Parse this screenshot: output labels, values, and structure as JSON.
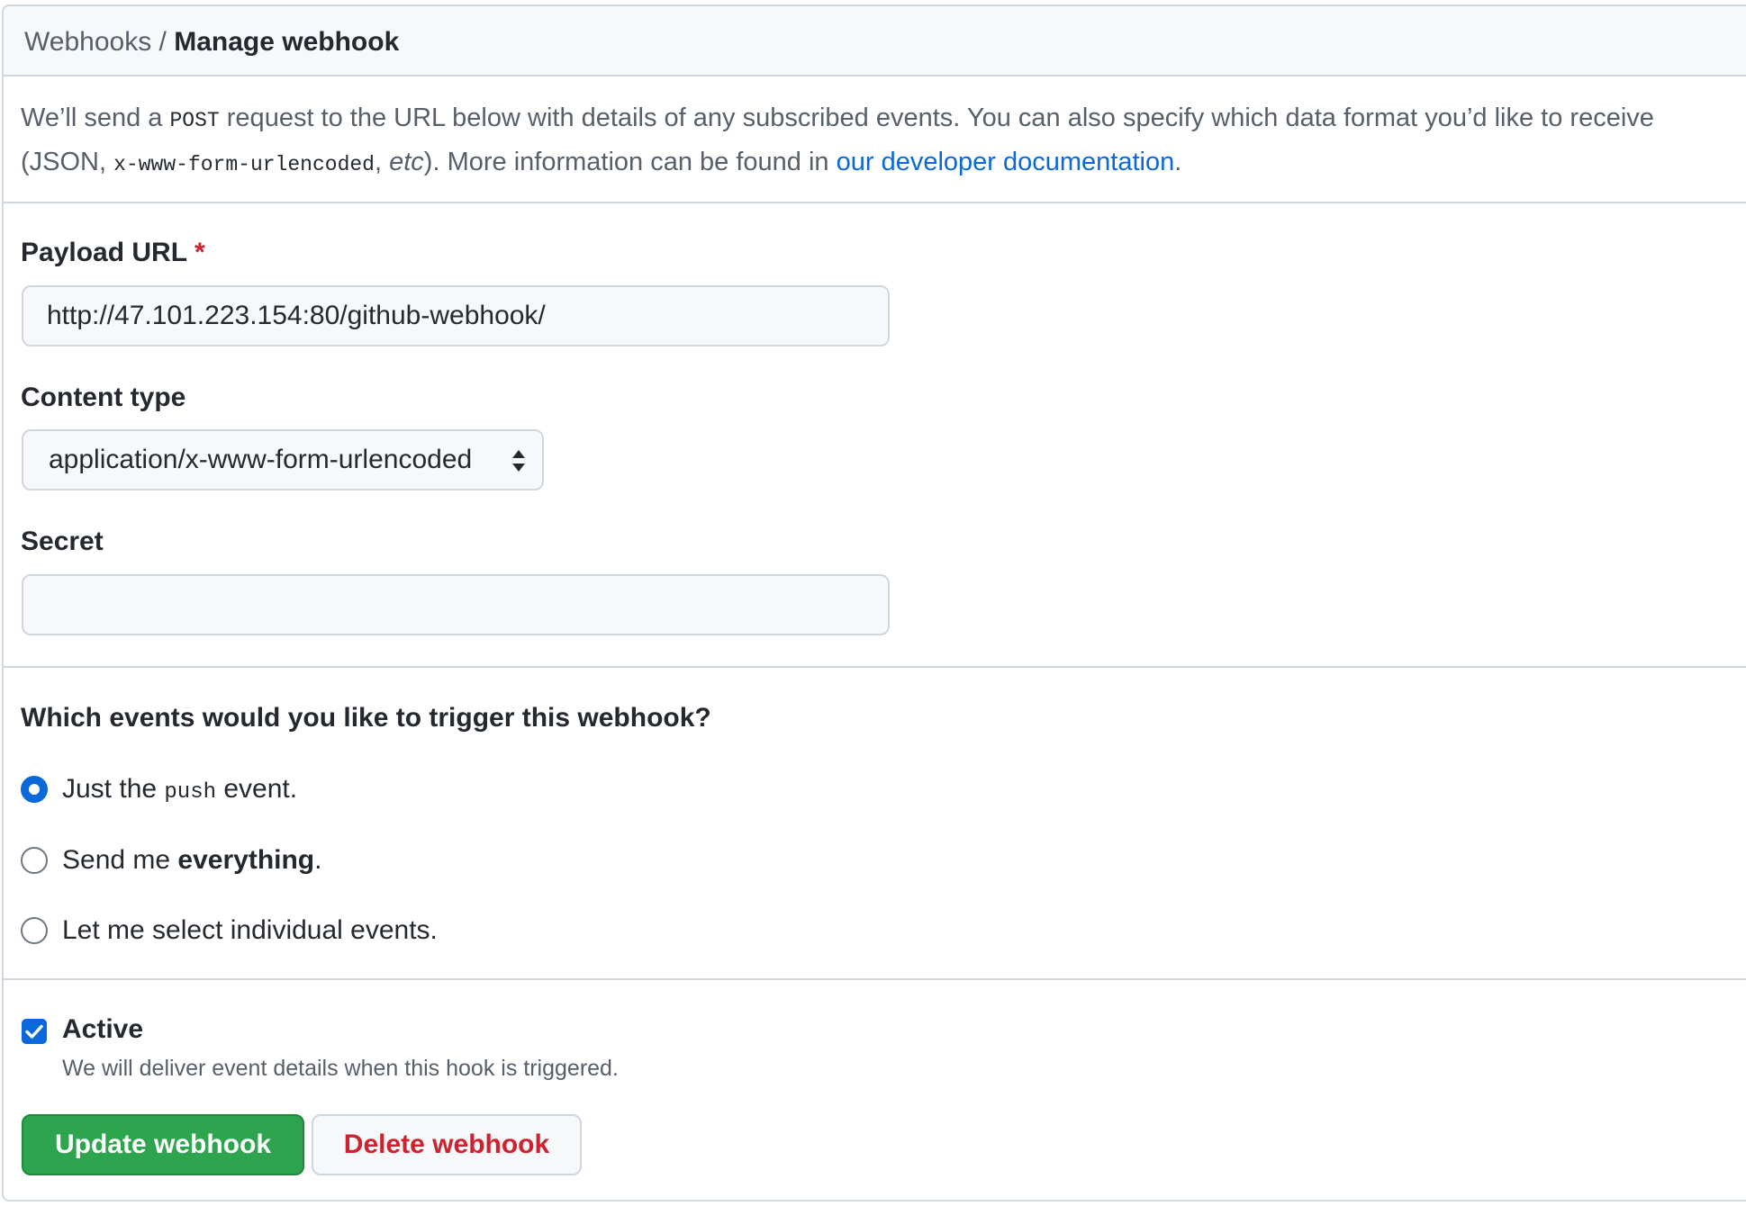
{
  "breadcrumb": {
    "parent": "Webhooks",
    "separator": " / ",
    "current": "Manage webhook"
  },
  "intro": {
    "t1": "We’ll send a ",
    "code_method": "POST",
    "t2": " request to the URL below with details of any subscribed events. You can also specify which data format you’d like to receive",
    "t3": "(JSON, ",
    "code_format": "x-www-form-urlencoded",
    "t4": ", ",
    "etc": "etc",
    "t5": "). More information can be found in ",
    "link": "our developer documentation",
    "t6": "."
  },
  "payload_url": {
    "label": "Payload URL",
    "required_mark": "*",
    "value": "http://47.101.223.154:80/github-webhook/"
  },
  "content_type": {
    "label": "Content type",
    "selected": "application/x-www-form-urlencoded"
  },
  "secret": {
    "label": "Secret",
    "value": ""
  },
  "events": {
    "question": "Which events would you like to trigger this webhook?",
    "option_push": {
      "pre": "Just the ",
      "code": "push",
      "post": " event.",
      "checked": true
    },
    "option_everything": {
      "pre": "Send me ",
      "bold": "everything",
      "post": ".",
      "checked": false
    },
    "option_individual": {
      "label": "Let me select individual events.",
      "checked": false
    }
  },
  "active": {
    "label": "Active",
    "checked": true,
    "note": "We will deliver event details when this hook is triggered."
  },
  "buttons": {
    "update": "Update webhook",
    "delete": "Delete webhook"
  },
  "colors": {
    "accent": "#0969da",
    "primary_button": "#2da44e",
    "danger_text": "#cf222e",
    "border": "#d0d7de"
  }
}
